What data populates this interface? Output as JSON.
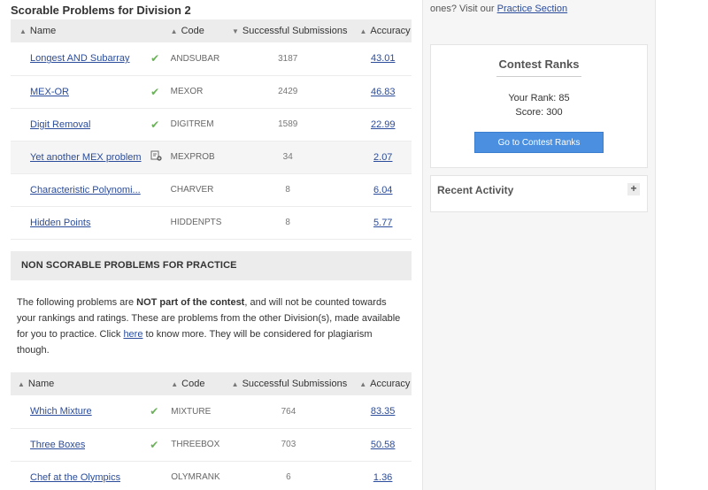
{
  "scorable": {
    "title": "Scorable Problems for Division 2",
    "headers": {
      "name": "Name",
      "code": "Code",
      "subs": "Successful Submissions",
      "accuracy": "Accuracy"
    },
    "rows": [
      {
        "name": "Longest AND Subarray",
        "status": "solved",
        "code": "ANDSUBAR",
        "subs": "3187",
        "accuracy": "43.01"
      },
      {
        "name": "MEX-OR",
        "status": "solved",
        "code": "MEXOR",
        "subs": "2429",
        "accuracy": "46.83"
      },
      {
        "name": "Digit Removal",
        "status": "solved",
        "code": "DIGITREM",
        "subs": "1589",
        "accuracy": "22.99"
      },
      {
        "name": "Yet another MEX problem",
        "status": "attempted",
        "code": "MEXPROB",
        "subs": "34",
        "accuracy": "2.07"
      },
      {
        "name": "Characteristic Polynomi...",
        "status": "none",
        "code": "CHARVER",
        "subs": "8",
        "accuracy": "6.04"
      },
      {
        "name": "Hidden Points",
        "status": "none",
        "code": "HIDDENPTS",
        "subs": "8",
        "accuracy": "5.77"
      }
    ]
  },
  "nonscorable": {
    "title": "NON SCORABLE PROBLEMS FOR PRACTICE",
    "para_prefix": "The following problems are ",
    "para_bold": "NOT part of the contest",
    "para_mid": ", and will not be counted towards your rankings and ratings. These are problems from the other Division(s), made available for you to practice. Click ",
    "para_link": "here",
    "para_suffix": " to know more. They will be considered for plagiarism though.",
    "headers": {
      "name": "Name",
      "code": "Code",
      "subs": "Successful Submissions",
      "accuracy": "Accuracy"
    },
    "rows": [
      {
        "name": "Which Mixture",
        "status": "solved",
        "code": "MIXTURE",
        "subs": "764",
        "accuracy": "83.35"
      },
      {
        "name": "Three Boxes",
        "status": "solved",
        "code": "THREEBOX",
        "subs": "703",
        "accuracy": "50.58"
      },
      {
        "name": "Chef at the Olympics",
        "status": "none",
        "code": "OLYMRANK",
        "subs": "6",
        "accuracy": "1.36"
      }
    ]
  },
  "sidebar": {
    "note_text": "ones? Visit our ",
    "note_link": "Practice Section",
    "ranks_title": "Contest Ranks",
    "your_rank": "Your Rank: 85",
    "score": "Score: 300",
    "ranks_button": "Go to Contest Ranks",
    "activity_title": "Recent Activity",
    "activity_toggle": "+"
  },
  "icons": {
    "sort": "sort-icon",
    "solved": "check-icon",
    "attempted": "attempted-icon",
    "expand": "plus-icon"
  },
  "colors": {
    "link": "#2b4c9b",
    "solved": "#6bb15a",
    "button": "#4a8fe0",
    "header_bg": "#ececec"
  }
}
